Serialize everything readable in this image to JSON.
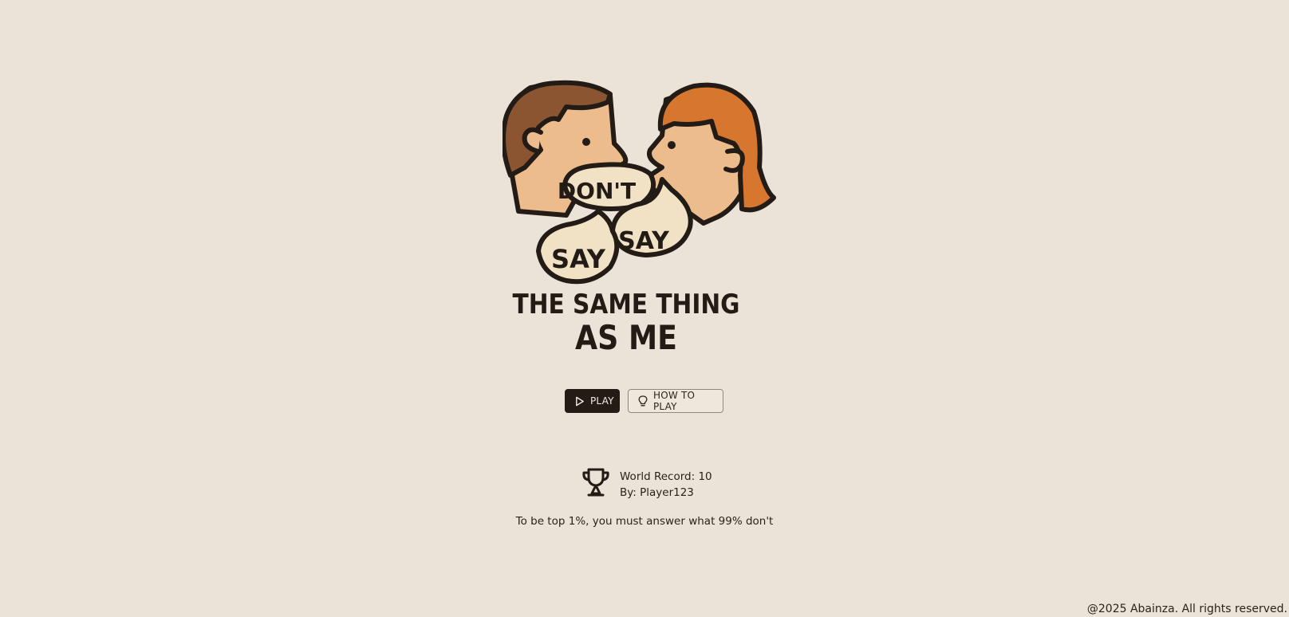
{
  "logo": {
    "bubble_dont": "DON'T",
    "bubble_say_left": "SAY",
    "bubble_say_right": "SAY",
    "title_line1": "THE SAME THING",
    "title_line2": "AS ME",
    "colors": {
      "outline": "#231b15",
      "skin": "#ecbc8c",
      "hair_left": "#8a5530",
      "hair_right": "#d7772f",
      "bubble": "#f1e2c6"
    }
  },
  "actions": {
    "play_label": "PLAY",
    "play_icon": "play-icon",
    "how_label": "HOW TO PLAY",
    "how_icon": "lightbulb-icon"
  },
  "record": {
    "icon": "trophy-icon",
    "line1": "World Record: 10",
    "line2": "By: Player123"
  },
  "tagline": "To be top 1%, you must answer what 99% don't",
  "footer": "@2025 Abainza. All rights reserved.",
  "colors": {
    "background": "#ebe3d8",
    "primary_button": "#231b15"
  }
}
